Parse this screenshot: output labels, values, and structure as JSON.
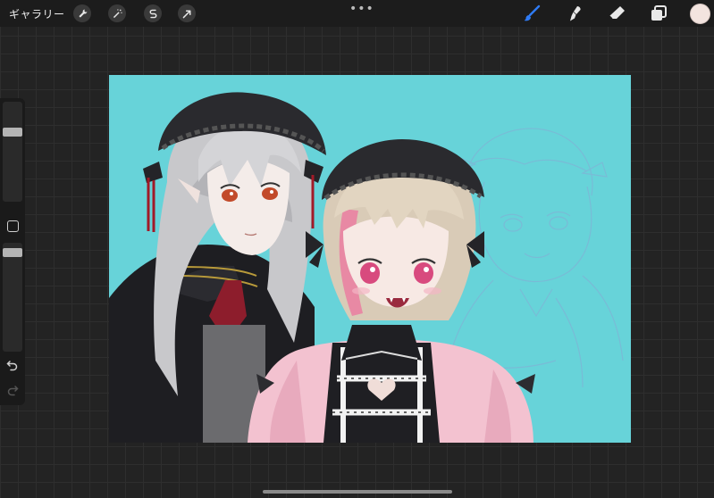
{
  "topbar": {
    "gallery_label": "ギャラリー",
    "more_label": "•••",
    "left_tools": [
      "wrench-icon",
      "magic-wand-icon",
      "selection-s-icon",
      "arrow-transform-icon"
    ],
    "right_tools": [
      "brush-icon",
      "smudge-icon",
      "eraser-icon",
      "layers-icon"
    ],
    "active_tool": "brush-icon",
    "active_color": "#f3e4df",
    "accent_color": "#2f7bf5"
  },
  "sidebar": {
    "brush_size_level": 0.72,
    "opacity_level": 0.95,
    "modify_button": "square-icon",
    "undo": "undo-icon",
    "redo": "redo-icon"
  },
  "canvas": {
    "background_color": "#67d3d9",
    "content": "illustration"
  }
}
